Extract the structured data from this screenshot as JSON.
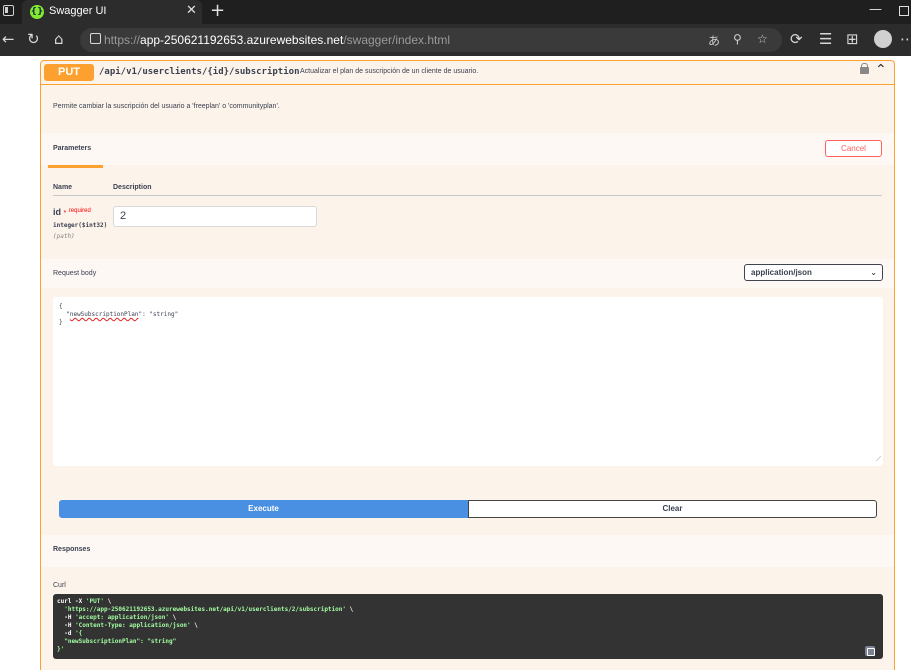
{
  "browser": {
    "tab_title": "Swagger UI",
    "favicon_glyph": "{}",
    "url_prefix": "https://",
    "url_host": "app-250621192653.azurewebsites.net",
    "url_path": "/swagger/index.html"
  },
  "operation": {
    "method": "PUT",
    "path": "/api/v1/userclients/{id}/subscription",
    "summary": "Actualizar el plan de suscripción de un cliente de usuario.",
    "description": "Permite cambiar la suscripción del usuario a 'freeplan' o 'communityplan'.",
    "accent_color": "#fca130"
  },
  "parameters": {
    "tab_label": "Parameters",
    "cancel_label": "Cancel",
    "col_name": "Name",
    "col_description": "Description",
    "items": [
      {
        "name": "id",
        "required_star": "*",
        "required_label": "required",
        "type": "integer($int32)",
        "in": "(path)",
        "value": "2"
      }
    ]
  },
  "request_body": {
    "title": "Request body",
    "content_type": "application/json",
    "lines": [
      "{",
      "  \"",
      "newSubscriptionPlan",
      "\": \"string\"",
      "}"
    ]
  },
  "actions": {
    "execute_label": "Execute",
    "clear_label": "Clear",
    "execute_color": "#4990e2"
  },
  "responses": {
    "title": "Responses",
    "curl_label": "Curl",
    "curl": {
      "l1_a": "curl -X ",
      "l1_b": "'PUT'",
      "l1_c": " \\",
      "l2_b": "'https://app-250621192653.azurewebsites.net/api/v1/userclients/2/subscription'",
      "l2_c": " \\",
      "l3_a": "  -H ",
      "l3_b": "'accept: application/json'",
      "l3_c": " \\",
      "l4_a": "  -H ",
      "l4_b": "'Content-Type: application/json'",
      "l4_c": " \\",
      "l5_a": "  -d ",
      "l5_b": "'{",
      "l6_b": "  \"newSubscriptionPlan\": \"string\"",
      "l7_b": "}'"
    }
  }
}
